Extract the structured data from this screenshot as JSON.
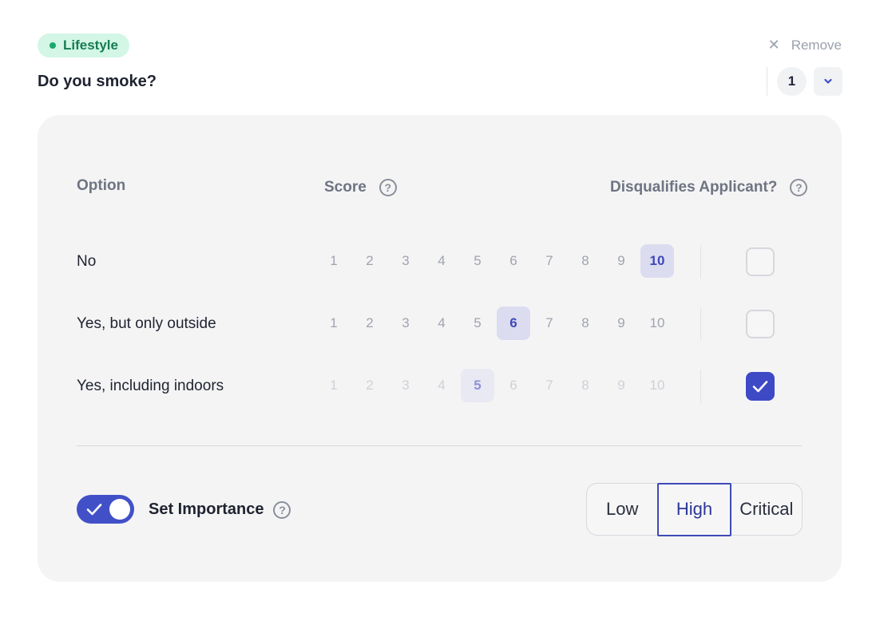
{
  "category": {
    "label": "Lifestyle",
    "color": "#1aa96c"
  },
  "remove": {
    "label": "Remove",
    "icon": "close-icon"
  },
  "question": {
    "title": "Do you smoke?",
    "order": "1"
  },
  "table": {
    "headers": {
      "option": "Option",
      "score": "Score",
      "disqualifies": "Disqualifies Applicant?"
    },
    "score_scale": [
      "1",
      "2",
      "3",
      "4",
      "5",
      "6",
      "7",
      "8",
      "9",
      "10"
    ],
    "rows": [
      {
        "label": "No",
        "selected_score": "10",
        "disqualifies": false,
        "faded": false
      },
      {
        "label": "Yes, but only outside",
        "selected_score": "6",
        "disqualifies": false,
        "faded": false
      },
      {
        "label": "Yes, including indoors",
        "selected_score": "5",
        "disqualifies": true,
        "faded": true
      }
    ]
  },
  "importance": {
    "toggle_label": "Set Importance",
    "enabled": true,
    "options": [
      "Low",
      "High",
      "Critical"
    ],
    "selected": "High"
  },
  "colors": {
    "accent": "#4250c8",
    "tag_bg": "#d3f6e6",
    "panel_bg": "#f4f4f5"
  }
}
